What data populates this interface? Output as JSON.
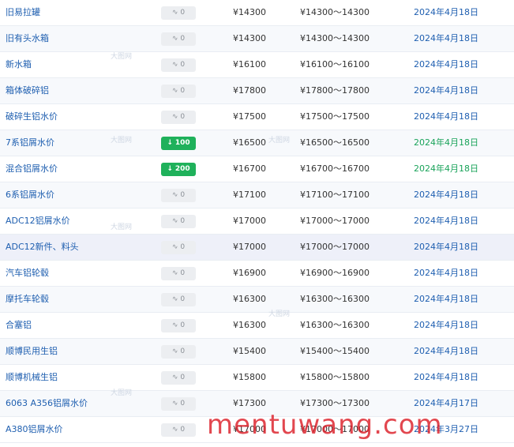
{
  "rows": [
    {
      "name": "旧易拉罐",
      "change": "0",
      "change_type": "flat",
      "price": "¥14300",
      "range": "¥14300～14300",
      "date": "2024年4月18日",
      "date_color": "blue"
    },
    {
      "name": "旧有头水箱",
      "change": "0",
      "change_type": "flat",
      "price": "¥14300",
      "range": "¥14300～14300",
      "date": "2024年4月18日",
      "date_color": "blue"
    },
    {
      "name": "新水箱",
      "change": "0",
      "change_type": "flat",
      "price": "¥16100",
      "range": "¥16100～16100",
      "date": "2024年4月18日",
      "date_color": "blue"
    },
    {
      "name": "箱体破碎铝",
      "change": "0",
      "change_type": "flat",
      "price": "¥17800",
      "range": "¥17800～17800",
      "date": "2024年4月18日",
      "date_color": "blue"
    },
    {
      "name": "破碎生铝水价",
      "change": "0",
      "change_type": "flat",
      "price": "¥17500",
      "range": "¥17500～17500",
      "date": "2024年4月18日",
      "date_color": "blue"
    },
    {
      "name": "7系铝屑水价",
      "change": "100",
      "change_type": "down",
      "price": "¥16500",
      "range": "¥16500～16500",
      "date": "2024年4月18日",
      "date_color": "green"
    },
    {
      "name": "混合铝屑水价",
      "change": "200",
      "change_type": "down",
      "price": "¥16700",
      "range": "¥16700～16700",
      "date": "2024年4月18日",
      "date_color": "green"
    },
    {
      "name": "6系铝屑水价",
      "change": "0",
      "change_type": "flat",
      "price": "¥17100",
      "range": "¥17100～17100",
      "date": "2024年4月18日",
      "date_color": "blue"
    },
    {
      "name": "ADC12铝屑水价",
      "change": "0",
      "change_type": "flat",
      "price": "¥17000",
      "range": "¥17000～17000",
      "date": "2024年4月18日",
      "date_color": "blue"
    },
    {
      "name": "ADC12新件、料头",
      "change": "0",
      "change_type": "flat",
      "price": "¥17000",
      "range": "¥17000～17000",
      "date": "2024年4月18日",
      "date_color": "blue"
    },
    {
      "name": "汽车铝轮毂",
      "change": "0",
      "change_type": "flat",
      "price": "¥16900",
      "range": "¥16900～16900",
      "date": "2024年4月18日",
      "date_color": "blue"
    },
    {
      "name": "摩托车轮毂",
      "change": "0",
      "change_type": "flat",
      "price": "¥16300",
      "range": "¥16300～16300",
      "date": "2024年4月18日",
      "date_color": "blue"
    },
    {
      "name": "合塞铝",
      "change": "0",
      "change_type": "flat",
      "price": "¥16300",
      "range": "¥16300～16300",
      "date": "2024年4月18日",
      "date_color": "blue"
    },
    {
      "name": "顺博民用生铝",
      "change": "0",
      "change_type": "flat",
      "price": "¥15400",
      "range": "¥15400～15400",
      "date": "2024年4月18日",
      "date_color": "blue"
    },
    {
      "name": "顺博机械生铝",
      "change": "0",
      "change_type": "flat",
      "price": "¥15800",
      "range": "¥15800～15800",
      "date": "2024年4月18日",
      "date_color": "blue"
    },
    {
      "name": "6063 A356铝屑水价",
      "change": "0",
      "change_type": "flat",
      "price": "¥17300",
      "range": "¥17300～17300",
      "date": "2024年4月17日",
      "date_color": "blue"
    },
    {
      "name": "A380铝屑水价",
      "change": "0",
      "change_type": "flat",
      "price": "¥17000",
      "range": "¥17000～17000",
      "date": "2024年3月27日",
      "date_color": "blue"
    }
  ],
  "icons": {
    "flat": "flat-trend-icon",
    "down": "down-arrow-icon"
  },
  "colors": {
    "link_blue": "#1f5fb0",
    "up_green": "#1aa35a",
    "badge_green": "#1fb15b",
    "badge_gray": "#eceef1",
    "watermark_red": "#dc1e28"
  },
  "watermarks": {
    "site": "大图网",
    "overlay": "mentuwang.com"
  }
}
